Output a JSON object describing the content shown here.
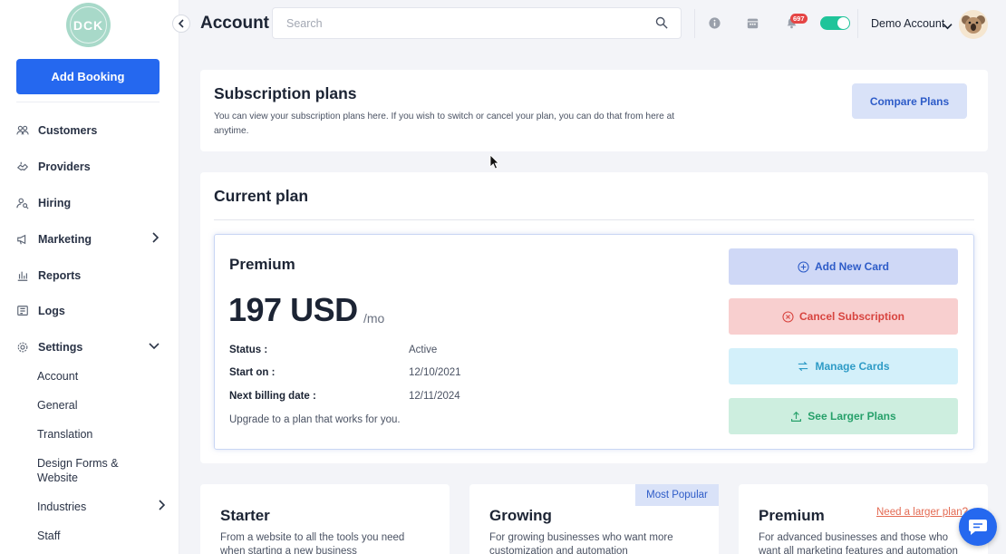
{
  "sidebar": {
    "logo_text": "DCK",
    "add_booking": "Add Booking",
    "items": [
      {
        "label": "Customers",
        "icon": "users-icon"
      },
      {
        "label": "Providers",
        "icon": "handshake-icon"
      },
      {
        "label": "Hiring",
        "icon": "user-search-icon"
      },
      {
        "label": "Marketing",
        "icon": "megaphone-icon"
      },
      {
        "label": "Reports",
        "icon": "bar-chart-icon"
      },
      {
        "label": "Logs",
        "icon": "book-icon"
      },
      {
        "label": "Settings",
        "icon": "gear-icon"
      }
    ],
    "settings_sub": [
      "Account",
      "General",
      "Translation",
      "Design Forms & Website",
      "Industries",
      "Staff"
    ]
  },
  "header": {
    "title": "Account",
    "search_placeholder": "Search",
    "notification_count": "697",
    "account_name": "Demo Account"
  },
  "subscription": {
    "title": "Subscription plans",
    "description": "You can view your subscription plans here. If you wish to switch or cancel your plan, you can do that from here at anytime.",
    "compare_button": "Compare Plans"
  },
  "current_plan": {
    "title": "Current plan",
    "plan_name": "Premium",
    "price": "197 USD",
    "period": "/mo",
    "status_label": "Status :",
    "status_value": "Active",
    "start_label": "Start on :",
    "start_value": "12/10/2021",
    "billing_label": "Next billing date :",
    "billing_value": "12/11/2024",
    "upgrade_text": "Upgrade to a plan that works for you.",
    "buttons": {
      "add_card": "Add New Card",
      "cancel": "Cancel Subscription",
      "manage": "Manage Cards",
      "larger": "See Larger Plans"
    }
  },
  "tiers": [
    {
      "name": "Starter",
      "desc": "From a website to all the tools you need when starting a new business"
    },
    {
      "name": "Growing",
      "desc": "For growing businesses who want more customization and automation",
      "badge": "Most Popular"
    },
    {
      "name": "Premium",
      "desc": "For advanced businesses and those who want all marketing features and automation",
      "link": "Need a larger plan?"
    }
  ],
  "colors": {
    "primary": "#2568ef",
    "cancel": "#d8443f",
    "manage": "#2e9bc6",
    "success": "#26a06a"
  }
}
